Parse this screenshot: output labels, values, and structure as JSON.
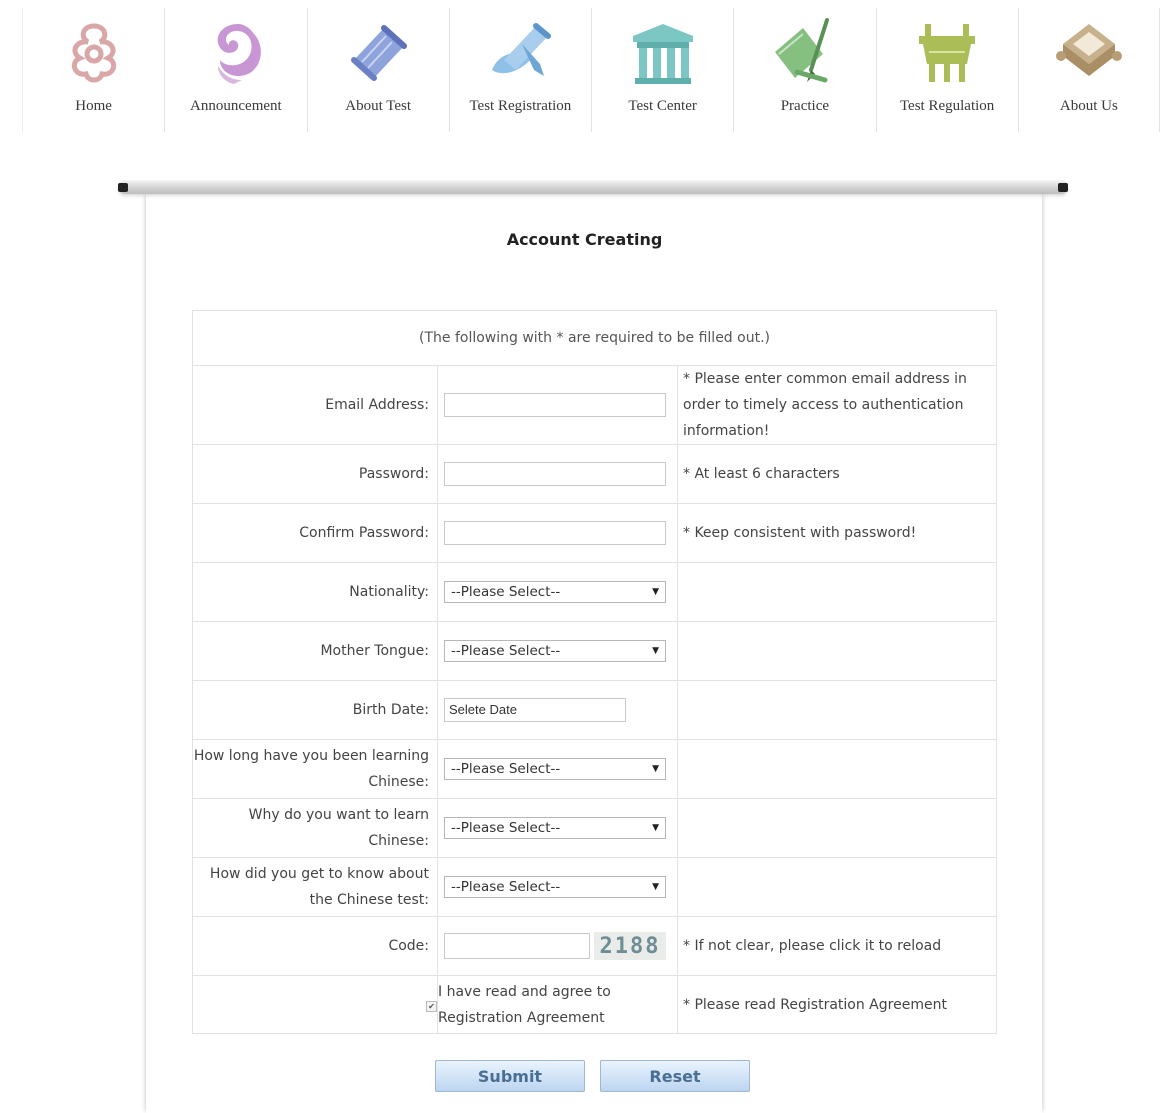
{
  "nav": [
    {
      "label": "Home",
      "icon": "cloud-knot-icon",
      "color": "#d9a7a7"
    },
    {
      "label": "Announcement",
      "icon": "swirl-cloud-icon",
      "color": "#b27cc0"
    },
    {
      "label": "About Test",
      "icon": "scroll-icon",
      "color": "#7f95d1"
    },
    {
      "label": "Test Registration",
      "icon": "brush-scroll-icon",
      "color": "#7ab0de"
    },
    {
      "label": "Test Center",
      "icon": "gate-building-icon",
      "color": "#76c3c0"
    },
    {
      "label": "Practice",
      "icon": "writing-brush-icon",
      "color": "#74b86f"
    },
    {
      "label": "Test Regulation",
      "icon": "bronze-vessel-icon",
      "color": "#a6b84e"
    },
    {
      "label": "About Us",
      "icon": "ornament-box-icon",
      "color": "#b49a72"
    }
  ],
  "form": {
    "title": "Account Creating",
    "note": "(The following with * are required to be filled out.)",
    "fields": {
      "email": {
        "label": "Email Address:",
        "value": "",
        "hint": "* Please enter common email address in order to timely access to authentication information!"
      },
      "password": {
        "label": "Password:",
        "value": "",
        "hint": "* At least 6 characters"
      },
      "confirm": {
        "label": "Confirm Password:",
        "value": "",
        "hint": "* Keep consistent with password!"
      },
      "nationality": {
        "label": "Nationality:",
        "selected": "--Please Select--"
      },
      "mother_tongue": {
        "label": "Mother Tongue:",
        "selected": "--Please Select--"
      },
      "birth_date": {
        "label": "Birth Date:",
        "value": "Selete Date"
      },
      "learning_duration": {
        "label": "How long have you been learning Chinese:",
        "selected": "--Please Select--"
      },
      "learning_reason": {
        "label": "Why do you want to learn Chinese:",
        "selected": "--Please Select--"
      },
      "source": {
        "label": "How did you get to know about the Chinese test:",
        "selected": "--Please Select--"
      },
      "code": {
        "label": "Code:",
        "value": "",
        "captcha": "2188",
        "hint": "* If not clear, please click it to reload"
      },
      "agreement": {
        "text": "I have read and agree to Registration Agreement",
        "checked": true,
        "hint": "* Please read Registration Agreement"
      }
    },
    "buttons": {
      "submit": "Submit",
      "reset": "Reset"
    }
  }
}
